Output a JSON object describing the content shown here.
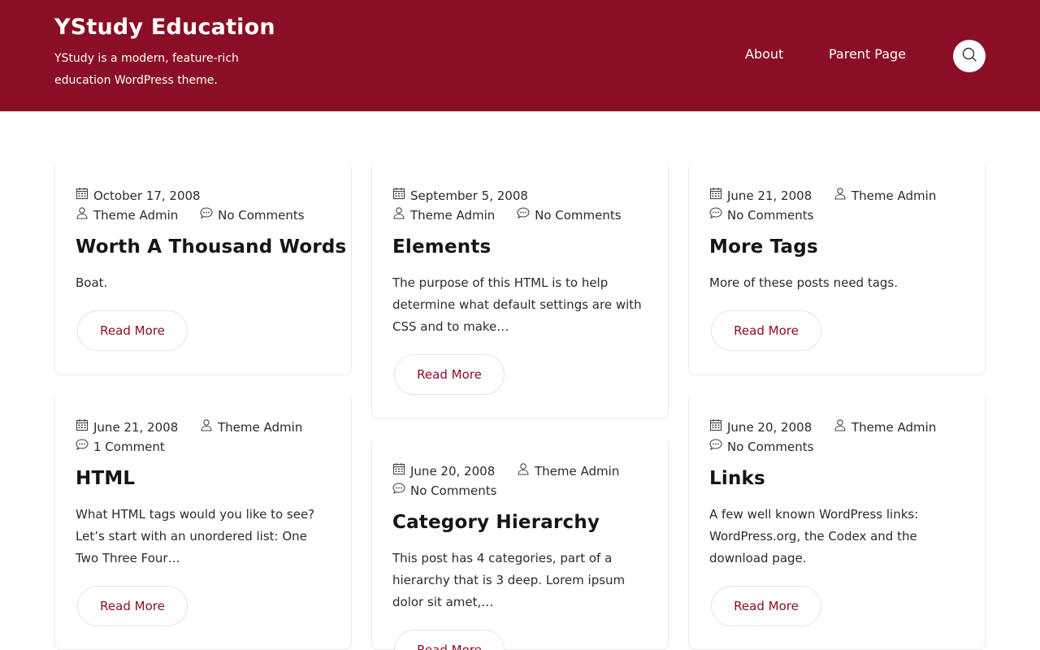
{
  "site": {
    "title": "YStudy Education",
    "tagline": "YStudy is a modern, feature-rich education WordPress theme."
  },
  "nav": {
    "items": [
      {
        "label": "About"
      },
      {
        "label": "Parent Page"
      }
    ],
    "search_icon": "search-icon"
  },
  "colors": {
    "brand": "#8a0e24",
    "text": "#1b1b1b",
    "card_border": "#e9e9ee"
  },
  "posts": [
    {
      "date": "October 17, 2008",
      "author": "Theme Admin",
      "comments": "No Comments",
      "title": "Worth A Thousand Words",
      "excerpt": "Boat.",
      "read_more": "Read More"
    },
    {
      "date": "September 5, 2008",
      "author": "Theme Admin",
      "comments": "No Comments",
      "title": "Elements",
      "excerpt": "The purpose of this HTML is to help determine what default settings are with CSS and to make…",
      "read_more": "Read More"
    },
    {
      "date": "June 21, 2008",
      "author": "Theme Admin",
      "comments": "No Comments",
      "title": "More Tags",
      "excerpt": "More of these posts need tags.",
      "read_more": "Read More"
    },
    {
      "date": "June 21, 2008",
      "author": "Theme Admin",
      "comments": "1 Comment",
      "title": "HTML",
      "excerpt": "What HTML tags would you like to see? Let’s start with an unordered list: One Two Three Four…",
      "read_more": "Read More"
    },
    {
      "date": "June 20, 2008",
      "author": "Theme Admin",
      "comments": "No Comments",
      "title": "Category Hierarchy",
      "excerpt": "This post has 4 categories, part of a hierarchy that is 3 deep. Lorem ipsum dolor sit amet,…",
      "read_more": "Read More"
    },
    {
      "date": "June 20, 2008",
      "author": "Theme Admin",
      "comments": "No Comments",
      "title": "Links",
      "excerpt": "A few well known WordPress links: WordPress.org, the Codex and the download page.",
      "read_more": "Read More"
    }
  ]
}
